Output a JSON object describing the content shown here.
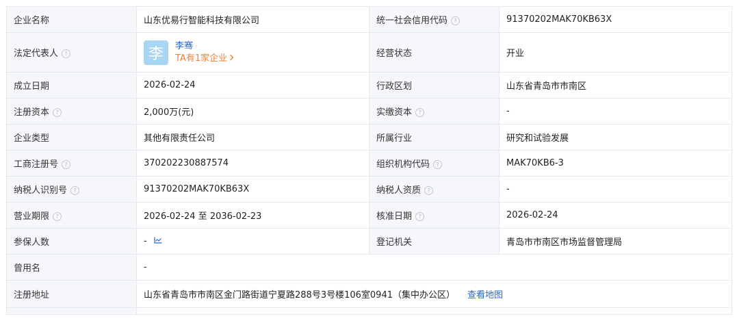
{
  "rows": [
    {
      "l1": "企业名称",
      "v1": "山东优易行智能科技有限公司",
      "l2": "统一社会信用代码",
      "v2": "91370202MAK70KB63X"
    },
    {
      "l1": "法定代表人",
      "rep_avatar": "李",
      "rep_name": "李骞",
      "rep_link": "TA有1家企业",
      "l2": "经营状态",
      "v2": "开业"
    },
    {
      "l1": "成立日期",
      "v1": "2026-02-24",
      "l2": "行政区划",
      "v2": "山东省青岛市市南区"
    },
    {
      "l1": "注册资本",
      "v1": "2,000万(元)",
      "l2": "实缴资本",
      "v2": "-"
    },
    {
      "l1": "企业类型",
      "v1": "其他有限责任公司",
      "l2": "所属行业",
      "v2": "研究和试验发展"
    },
    {
      "l1": "工商注册号",
      "v1": "370202230887574",
      "l2": "组织机构代码",
      "v2": "MAK70KB6-3"
    },
    {
      "l1": "纳税人识别号",
      "v1": "91370202MAK70KB63X",
      "l2": "纳税人资质",
      "v2": "-"
    },
    {
      "l1": "营业期限",
      "v1": "2026-02-24 至 2036-02-23",
      "l2": "核准日期",
      "v2": "2026-02-24"
    },
    {
      "l1": "参保人数",
      "v1": "-",
      "l2": "登记机关",
      "v2": "青岛市市南区市场监督管理局"
    },
    {
      "l1": "曾用名",
      "v1": "-"
    },
    {
      "l1": "注册地址",
      "v1": "山东省青岛市市南区金门路街道宁夏路288号3号楼106室0941（集中办公区）",
      "map_link": "查看地图"
    }
  ],
  "icons": {
    "help": "help-circle-icon",
    "trend": "trend-chart-icon",
    "chevron": "chevron-right-icon"
  },
  "colors": {
    "label_bg": "#f5f7fa",
    "border": "#e4e8ef",
    "link_blue": "#2a66d1",
    "link_orange": "#f0833a",
    "avatar_bg": "#a8d6f2"
  }
}
